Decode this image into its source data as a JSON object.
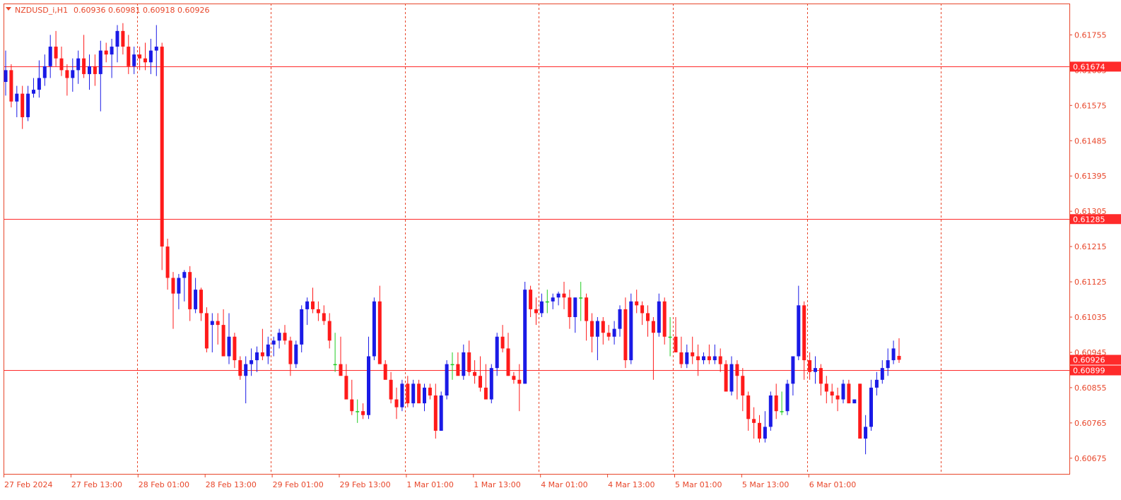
{
  "header": {
    "symbol": "NZDUSD_i,H1",
    "ohlc": "0.60936 0.60981 0.60918 0.60926"
  },
  "colors": {
    "bull": "#1a1ae6",
    "bear": "#ff1a1a",
    "neutral": "#22cc22",
    "grid": "#e8462a",
    "level": "#ff2a2a",
    "frame": "#e8462a"
  },
  "chart_data": {
    "type": "candlestick",
    "symbol": "NZDUSD_i",
    "timeframe": "H1",
    "ylim": [
      0.60635,
      0.61835
    ],
    "y_ticks": [
      "0.61755",
      "0.61665",
      "0.61575",
      "0.61485",
      "0.61395",
      "0.61305",
      "0.61215",
      "0.61125",
      "0.61035",
      "0.60945",
      "0.60855",
      "0.60765",
      "0.60675"
    ],
    "time_labels": [
      "27 Feb 2024",
      "27 Feb 13:00",
      "28 Feb 01:00",
      "28 Feb 13:00",
      "29 Feb 01:00",
      "29 Feb 13:00",
      "1 Mar 01:00",
      "1 Mar 13:00",
      "4 Mar 01:00",
      "4 Mar 13:00",
      "5 Mar 01:00",
      "5 Mar 13:00",
      "6 Mar 01:00"
    ],
    "day_separators": [
      23,
      47,
      71,
      95,
      119,
      143,
      167
    ],
    "horizontal_levels": [
      {
        "value": "0.61674"
      },
      {
        "value": "0.61285"
      },
      {
        "value": "0.60899"
      }
    ],
    "current_price": "0.60926",
    "candles": [
      [
        0.61635,
        0.61715,
        0.616,
        0.61665
      ],
      [
        0.61665,
        0.6168,
        0.6157,
        0.61585
      ],
      [
        0.61585,
        0.61625,
        0.61545,
        0.61605
      ],
      [
        0.61605,
        0.61625,
        0.61515,
        0.61545
      ],
      [
        0.61545,
        0.61625,
        0.61535,
        0.61605
      ],
      [
        0.61605,
        0.61645,
        0.61595,
        0.61615
      ],
      [
        0.61615,
        0.6169,
        0.61595,
        0.61645
      ],
      [
        0.61645,
        0.61705,
        0.61625,
        0.61675
      ],
      [
        0.61675,
        0.61755,
        0.61645,
        0.61725
      ],
      [
        0.61725,
        0.61765,
        0.61675,
        0.61695
      ],
      [
        0.61695,
        0.61725,
        0.6165,
        0.61665
      ],
      [
        0.61665,
        0.6168,
        0.616,
        0.61645
      ],
      [
        0.61645,
        0.61695,
        0.6161,
        0.61665
      ],
      [
        0.61665,
        0.61715,
        0.6163,
        0.61695
      ],
      [
        0.61695,
        0.61755,
        0.61645,
        0.61655
      ],
      [
        0.61655,
        0.61705,
        0.61615,
        0.61675
      ],
      [
        0.61675,
        0.61705,
        0.61625,
        0.61655
      ],
      [
        0.61655,
        0.6174,
        0.6156,
        0.61715
      ],
      [
        0.61715,
        0.61735,
        0.61685,
        0.61705
      ],
      [
        0.61705,
        0.61745,
        0.61645,
        0.61725
      ],
      [
        0.61725,
        0.6178,
        0.61685,
        0.61765
      ],
      [
        0.61765,
        0.61785,
        0.61705,
        0.61725
      ],
      [
        0.61725,
        0.61755,
        0.61655,
        0.61675
      ],
      [
        0.61675,
        0.61725,
        0.61655,
        0.61705
      ],
      [
        0.61705,
        0.61725,
        0.61665,
        0.61695
      ],
      [
        0.61695,
        0.61735,
        0.61665,
        0.61685
      ],
      [
        0.61685,
        0.61745,
        0.61655,
        0.61715
      ],
      [
        0.61715,
        0.6178,
        0.6165,
        0.61725
      ],
      [
        0.61725,
        0.61735,
        0.61155,
        0.61215
      ],
      [
        0.61215,
        0.61235,
        0.61105,
        0.61135
      ],
      [
        0.61135,
        0.6115,
        0.61005,
        0.61095
      ],
      [
        0.61095,
        0.61145,
        0.61055,
        0.61135
      ],
      [
        0.61135,
        0.61155,
        0.61075,
        0.6115
      ],
      [
        0.6115,
        0.61165,
        0.61025,
        0.61055
      ],
      [
        0.61055,
        0.61135,
        0.61045,
        0.61105
      ],
      [
        0.61105,
        0.6111,
        0.61025,
        0.61045
      ],
      [
        0.61045,
        0.6106,
        0.60945,
        0.60955
      ],
      [
        0.61015,
        0.61045,
        0.60945,
        0.61025
      ],
      [
        0.61025,
        0.61045,
        0.60965,
        0.61015
      ],
      [
        0.61015,
        0.61055,
        0.60935,
        0.60935
      ],
      [
        0.60935,
        0.61045,
        0.60915,
        0.60985
      ],
      [
        0.60985,
        0.60995,
        0.60905,
        0.60925
      ],
      [
        0.60925,
        0.60935,
        0.60875,
        0.60885
      ],
      [
        0.60885,
        0.60935,
        0.60815,
        0.60915
      ],
      [
        0.60915,
        0.60955,
        0.60885,
        0.60925
      ],
      [
        0.60925,
        0.6096,
        0.60895,
        0.60945
      ],
      [
        0.60945,
        0.61005,
        0.60925,
        0.60935
      ],
      [
        0.60935,
        0.60985,
        0.60915,
        0.60965
      ],
      [
        0.60965,
        0.60985,
        0.60935,
        0.60975
      ],
      [
        0.60975,
        0.61005,
        0.60955,
        0.60995
      ],
      [
        0.60995,
        0.61015,
        0.60965,
        0.60975
      ],
      [
        0.60975,
        0.60985,
        0.60885,
        0.60915
      ],
      [
        0.60915,
        0.60975,
        0.60905,
        0.60965
      ],
      [
        0.60965,
        0.61065,
        0.60945,
        0.61055
      ],
      [
        0.61055,
        0.61085,
        0.61015,
        0.61075
      ],
      [
        0.61075,
        0.6111,
        0.61045,
        0.61055
      ],
      [
        0.61055,
        0.61075,
        0.61025,
        0.61045
      ],
      [
        0.61045,
        0.61065,
        0.61015,
        0.61025
      ],
      [
        0.61025,
        0.61045,
        0.60955,
        0.60975
      ],
      [
        0.60915,
        0.60995,
        0.60895,
        0.60915
      ],
      [
        0.60915,
        0.60985,
        0.60895,
        0.60885
      ],
      [
        0.60885,
        0.60915,
        0.60835,
        0.60825
      ],
      [
        0.60825,
        0.60875,
        0.60785,
        0.60795
      ],
      [
        0.60795,
        0.60825,
        0.60765,
        0.60795
      ],
      [
        0.60795,
        0.60815,
        0.60775,
        0.60785
      ],
      [
        0.60785,
        0.60985,
        0.60775,
        0.60935
      ],
      [
        0.60935,
        0.61085,
        0.60925,
        0.61075
      ],
      [
        0.61075,
        0.61115,
        0.60925,
        0.60915
      ],
      [
        0.60915,
        0.60925,
        0.60885,
        0.60875
      ],
      [
        0.60875,
        0.60895,
        0.60815,
        0.60825
      ],
      [
        0.60825,
        0.60855,
        0.60775,
        0.60805
      ],
      [
        0.60805,
        0.60875,
        0.60795,
        0.60865
      ],
      [
        0.60865,
        0.60885,
        0.60805,
        0.60815
      ],
      [
        0.60815,
        0.60875,
        0.60805,
        0.60865
      ],
      [
        0.60865,
        0.60875,
        0.60815,
        0.60815
      ],
      [
        0.60815,
        0.60865,
        0.60795,
        0.60855
      ],
      [
        0.60855,
        0.60865,
        0.60825,
        0.60835
      ],
      [
        0.60835,
        0.60865,
        0.60725,
        0.60745
      ],
      [
        0.60745,
        0.60845,
        0.60745,
        0.60835
      ],
      [
        0.60835,
        0.60925,
        0.60825,
        0.60915
      ],
      [
        0.60915,
        0.60945,
        0.60875,
        0.60915
      ],
      [
        0.60915,
        0.60945,
        0.60895,
        0.60885
      ],
      [
        0.60885,
        0.60965,
        0.60875,
        0.60945
      ],
      [
        0.60945,
        0.60975,
        0.60885,
        0.60895
      ],
      [
        0.60895,
        0.60925,
        0.60865,
        0.60885
      ],
      [
        0.60885,
        0.60935,
        0.60845,
        0.60855
      ],
      [
        0.60855,
        0.60915,
        0.60825,
        0.60825
      ],
      [
        0.60825,
        0.60915,
        0.60815,
        0.60905
      ],
      [
        0.60905,
        0.60995,
        0.60885,
        0.60985
      ],
      [
        0.60985,
        0.61015,
        0.60945,
        0.60955
      ],
      [
        0.60955,
        0.60995,
        0.60885,
        0.60885
      ],
      [
        0.60885,
        0.60895,
        0.60865,
        0.60875
      ],
      [
        0.60875,
        0.60915,
        0.60795,
        0.60865
      ],
      [
        0.60865,
        0.61125,
        0.60865,
        0.61105
      ],
      [
        0.61105,
        0.61115,
        0.61035,
        0.61055
      ],
      [
        0.61055,
        0.61085,
        0.61015,
        0.61045
      ],
      [
        0.61045,
        0.61095,
        0.61035,
        0.61075
      ],
      [
        0.61075,
        0.61105,
        0.61045,
        0.61075
      ],
      [
        0.61075,
        0.61095,
        0.61055,
        0.61085
      ],
      [
        0.61085,
        0.611,
        0.61065,
        0.61095
      ],
      [
        0.61095,
        0.61125,
        0.61055,
        0.61085
      ],
      [
        0.61085,
        0.61105,
        0.61005,
        0.61035
      ],
      [
        0.61035,
        0.61085,
        0.60995,
        0.61085
      ],
      [
        0.61085,
        0.61125,
        0.61025,
        0.61085
      ],
      [
        0.61085,
        0.61095,
        0.60975,
        0.61025
      ],
      [
        0.61025,
        0.61045,
        0.60945,
        0.60985
      ],
      [
        0.60985,
        0.61035,
        0.60925,
        0.61025
      ],
      [
        0.61025,
        0.61035,
        0.60965,
        0.60995
      ],
      [
        0.60995,
        0.61015,
        0.60975,
        0.60985
      ],
      [
        0.60985,
        0.61025,
        0.60965,
        0.61005
      ],
      [
        0.61005,
        0.61065,
        0.60985,
        0.61055
      ],
      [
        0.61055,
        0.61085,
        0.60905,
        0.60925
      ],
      [
        0.60925,
        0.61095,
        0.60915,
        0.61075
      ],
      [
        0.61075,
        0.61105,
        0.61045,
        0.61065
      ],
      [
        0.61065,
        0.61075,
        0.61015,
        0.61045
      ],
      [
        0.61045,
        0.61065,
        0.60985,
        0.61025
      ],
      [
        0.61025,
        0.61035,
        0.60875,
        0.60995
      ],
      [
        0.60995,
        0.61095,
        0.60985,
        0.61075
      ],
      [
        0.61075,
        0.61085,
        0.60965,
        0.60985
      ],
      [
        0.60985,
        0.61035,
        0.60935,
        0.60985
      ],
      [
        0.60985,
        0.61035,
        0.60955,
        0.60945
      ],
      [
        0.60945,
        0.60985,
        0.60905,
        0.60915
      ],
      [
        0.60915,
        0.60965,
        0.60905,
        0.60945
      ],
      [
        0.60945,
        0.60985,
        0.60915,
        0.60935
      ],
      [
        0.60935,
        0.60965,
        0.60885,
        0.60925
      ],
      [
        0.60925,
        0.60945,
        0.60915,
        0.60935
      ],
      [
        0.60935,
        0.60965,
        0.60915,
        0.60925
      ],
      [
        0.60925,
        0.60965,
        0.60915,
        0.60935
      ],
      [
        0.60935,
        0.60955,
        0.60895,
        0.60915
      ],
      [
        0.60915,
        0.60925,
        0.60845,
        0.60845
      ],
      [
        0.60845,
        0.60935,
        0.60835,
        0.60915
      ],
      [
        0.60915,
        0.60925,
        0.60825,
        0.60885
      ],
      [
        0.60885,
        0.60905,
        0.60795,
        0.60835
      ],
      [
        0.60835,
        0.60845,
        0.60745,
        0.60775
      ],
      [
        0.60775,
        0.60805,
        0.60725,
        0.60765
      ],
      [
        0.60765,
        0.60785,
        0.60715,
        0.60725
      ],
      [
        0.60725,
        0.60795,
        0.60715,
        0.60755
      ],
      [
        0.60755,
        0.60845,
        0.60745,
        0.60835
      ],
      [
        0.60835,
        0.60865,
        0.60775,
        0.60795
      ],
      [
        0.60795,
        0.60845,
        0.60785,
        0.60795
      ],
      [
        0.60795,
        0.60875,
        0.60785,
        0.60865
      ],
      [
        0.60865,
        0.60935,
        0.60835,
        0.60935
      ],
      [
        0.60935,
        0.61115,
        0.60925,
        0.61065
      ],
      [
        0.61065,
        0.61075,
        0.60875,
        0.60925
      ],
      [
        0.60925,
        0.60945,
        0.60875,
        0.60895
      ],
      [
        0.60895,
        0.60935,
        0.60865,
        0.60905
      ],
      [
        0.60905,
        0.60915,
        0.60835,
        0.60865
      ],
      [
        0.60865,
        0.60885,
        0.60815,
        0.60845
      ],
      [
        0.60845,
        0.60865,
        0.60815,
        0.60835
      ],
      [
        0.60835,
        0.60855,
        0.60795,
        0.60825
      ],
      [
        0.60825,
        0.60875,
        0.60815,
        0.60865
      ],
      [
        0.60865,
        0.60875,
        0.60815,
        0.60815
      ],
      [
        0.60815,
        0.60825,
        0.60815,
        0.60825
      ],
      [
        0.60865,
        0.60865,
        0.60725,
        0.60725
      ],
      [
        0.60725,
        0.60785,
        0.60685,
        0.60755
      ],
      [
        0.60755,
        0.60875,
        0.60745,
        0.60855
      ],
      [
        0.60855,
        0.60895,
        0.60835,
        0.60875
      ],
      [
        0.60875,
        0.60925,
        0.60865,
        0.60905
      ],
      [
        0.60905,
        0.60955,
        0.60885,
        0.60925
      ],
      [
        0.60925,
        0.60975,
        0.60915,
        0.60955
      ],
      [
        0.60936,
        0.60981,
        0.60918,
        0.60926
      ]
    ]
  }
}
